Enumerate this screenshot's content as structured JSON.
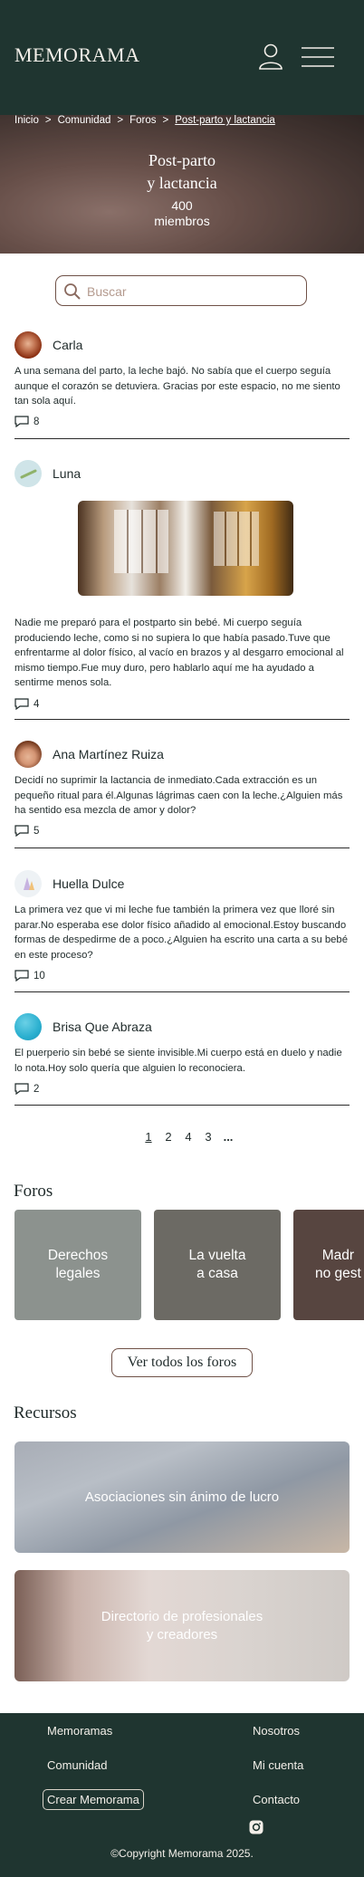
{
  "header": {
    "logo": "MEMORAMA",
    "icons": [
      "user-icon",
      "menu-icon"
    ]
  },
  "breadcrumb": [
    "Inicio",
    "Comunidad",
    "Foros",
    "Post-parto y lactancia"
  ],
  "hero": {
    "title_line1": "Post-parto",
    "title_line2": "y lactancia",
    "count": "400",
    "count_label": "miembros"
  },
  "search": {
    "placeholder": "Buscar"
  },
  "posts": [
    {
      "author": "Carla",
      "text": "A una semana del parto, la leche bajó. No sabía que el cuerpo seguía aunque el corazón se detuviera. Gracias por este espacio, no me siento tan sola aquí.",
      "comments": "8"
    },
    {
      "author": "Luna",
      "text": "Nadie me preparó para el postparto sin bebé. Mi cuerpo seguía produciendo leche, como si no supiera lo que había pasado.Tuve que enfrentarme al dolor físico, al vacío en brazos y al desgarro emocional al mismo tiempo.Fue muy duro, pero hablarlo aquí me ha ayudado a sentirme menos sola.",
      "comments": "4"
    },
    {
      "author": "Ana Martínez Ruiza",
      "text": "Decidí no suprimir la lactancia de inmediato.Cada extracción es un pequeño ritual para él.Algunas lágrimas caen con la leche.¿Alguien más ha sentido esa mezcla de amor y dolor?",
      "comments": "5"
    },
    {
      "author": "Huella Dulce",
      "text": "La primera vez que vi mi leche fue también la primera vez que lloré sin parar.No esperaba ese dolor físico añadido al emocional.Estoy buscando formas de despedirme de a poco.¿Alguien ha escrito una carta a su bebé en este proceso?",
      "comments": "10"
    },
    {
      "author": "Brisa Que Abraza",
      "text": "El puerperio sin bebé se siente invisible.Mi cuerpo está en duelo y nadie lo nota.Hoy solo quería que alguien lo reconociera.",
      "comments": "2"
    }
  ],
  "pagination": [
    "1",
    "2",
    "4",
    "3",
    "..."
  ],
  "foros": {
    "title": "Foros",
    "cards": [
      {
        "label": "Derechos\nlegales",
        "color": "#8c928e"
      },
      {
        "label": "La vuelta\na casa",
        "color": "#6c6a64"
      },
      {
        "label": "Madr\nno gest",
        "color": "#574540"
      }
    ],
    "button": "Ver todos los foros"
  },
  "recursos": {
    "title": "Recursos",
    "cards": [
      "Asociaciones sin ánimo de lucro",
      "Directorio de profesionales\ny creadores"
    ]
  },
  "footer": {
    "col1": [
      "Memoramas",
      "Comunidad",
      "Crear Memorama"
    ],
    "col2": [
      "Nosotros",
      "Mi cuenta",
      "Contacto"
    ],
    "copyright": "©Copyright Memorama 2025."
  }
}
